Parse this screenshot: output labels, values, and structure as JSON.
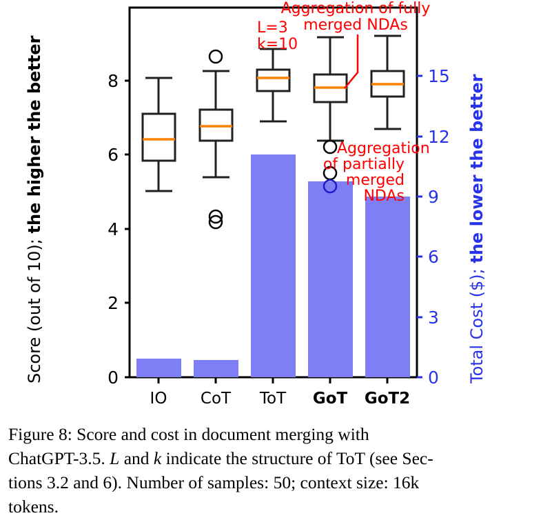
{
  "figure": {
    "caption_lines": [
      "Figure 8:  Score  and  cost  in  document  merging  with",
      "ChatGPT-3.5. L and k indicate the structure of ToT (see Sec-",
      "tions 3.2 and 6). Number of samples: 50; context size: 16k",
      "tokens."
    ],
    "caption_full": "Figure 8: Score and cost in document merging with ChatGPT-3.5. L and k indicate the structure of ToT (see Sections 3.2 and 6). Number of samples: 50; context size: 16k tokens."
  },
  "chart_data": {
    "type": "bar",
    "title": "",
    "categories": [
      "IO",
      "CoT",
      "ToT",
      "GoT",
      "GoT2"
    ],
    "bold_categories": [
      "GoT",
      "GoT2"
    ],
    "xlabel": "",
    "left_axis": {
      "label_plain": "Score (out of 10); ",
      "label_bold": "the higher the better",
      "ticks": [
        0,
        2,
        4,
        6,
        8
      ],
      "tick_labels": [
        "0",
        "2",
        "4",
        "6",
        "8"
      ],
      "ylim": [
        0,
        9.95
      ],
      "color": "#000000"
    },
    "right_axis": {
      "label_plain": "Total Cost ($); ",
      "label_bold": "the lower the better",
      "ticks": [
        0,
        3,
        6,
        9,
        12,
        15
      ],
      "tick_labels": [
        "0",
        "3",
        "6",
        "9",
        "12",
        "15"
      ],
      "ylim": [
        0,
        18.4
      ],
      "color": "#2832E8"
    },
    "series": [
      {
        "name": "Total Cost ($)",
        "type": "bar",
        "axis": "right",
        "color": "#7F7FF5",
        "values": [
          0.93,
          0.88,
          11.1,
          9.75,
          9.0
        ]
      },
      {
        "name": "Score (out of 10)",
        "type": "box",
        "axis": "left",
        "box_edge_color": "#202020",
        "median_color": "#FF8000",
        "boxes": [
          {
            "category": "IO",
            "whisker_low": 4.9,
            "q1": 5.72,
            "median": 6.42,
            "q3": 7.05,
            "whisker_high": 7.91,
            "outliers": []
          },
          {
            "category": "CoT",
            "whisker_low": 5.33,
            "q1": 6.35,
            "median": 6.67,
            "q3": 6.79,
            "whisker_high": 8.22,
            "outliers": [
              8.45,
              4.22,
              4.1
            ]
          },
          {
            "category": "ToT",
            "whisker_low": 6.8,
            "q1": 7.67,
            "median": 7.92,
            "q3": 8.1,
            "whisker_high": 8.66,
            "outliers": []
          },
          {
            "category": "GoT",
            "whisker_low": 6.35,
            "q1": 7.3,
            "median": 7.62,
            "q3": 8.0,
            "whisker_high": 8.97,
            "outliers": [
              6.1,
              5.4,
              5.08
            ]
          },
          {
            "category": "GoT2",
            "whisker_low": 6.58,
            "q1": 7.45,
            "median": 7.75,
            "q3": 8.08,
            "whisker_high": 8.99,
            "outliers": []
          }
        ]
      }
    ],
    "annotations": [
      {
        "name": "tot-structure",
        "text_lines": [
          "L=3",
          "k=10"
        ],
        "color": "#FF0000",
        "target": "ToT"
      },
      {
        "name": "fully-merged-ndas",
        "text_lines": [
          "Aggregation of fully",
          "merged NDAs"
        ],
        "color": "#FF0000",
        "target": "GoT"
      },
      {
        "name": "partially-merged-ndas",
        "text_lines": [
          "Aggregation",
          "of partially",
          "merged",
          "NDAs"
        ],
        "color": "#FF0000",
        "target": "GoT"
      }
    ],
    "grid": false,
    "legend": "none"
  }
}
